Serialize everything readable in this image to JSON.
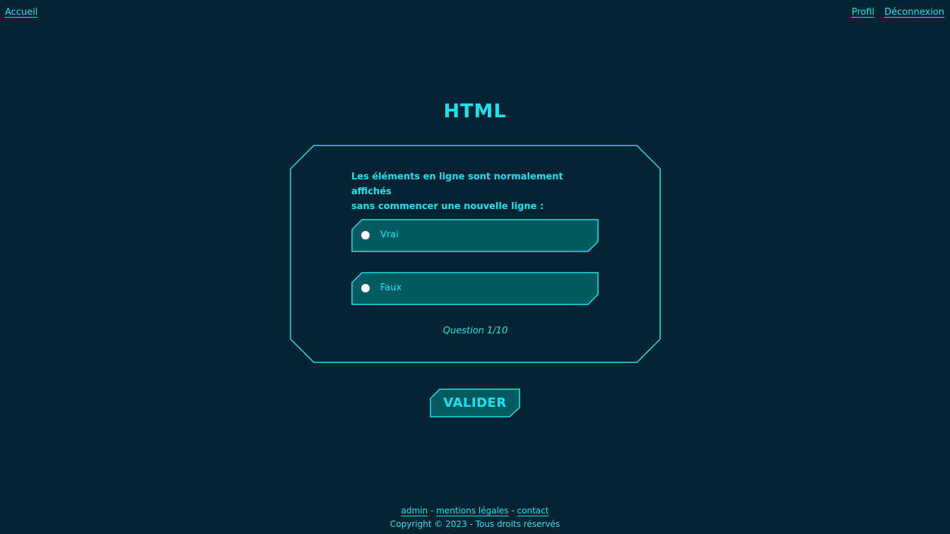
{
  "nav": {
    "home": "Accueil",
    "profile": "Profil",
    "logout": "Déconnexion"
  },
  "quiz": {
    "title": "HTML",
    "question_line1": "Les éléments en ligne sont normalement affichés",
    "question_line2": "sans commencer une nouvelle ligne :",
    "answers": [
      {
        "label": "Vrai",
        "selected": false
      },
      {
        "label": "Faux",
        "selected": false
      }
    ],
    "counter": "Question 1/10",
    "submit_label": "VALIDER"
  },
  "footer": {
    "admin": "admin",
    "separator": "-",
    "legal": "mentions légales",
    "contact": "contact",
    "copyright": "Copyright © 2023 - Tous droits réservés"
  },
  "colors": {
    "background": "#062331",
    "accent": "#16e4f0",
    "answer_fill": "#035a61",
    "radio": "#ffffff"
  }
}
